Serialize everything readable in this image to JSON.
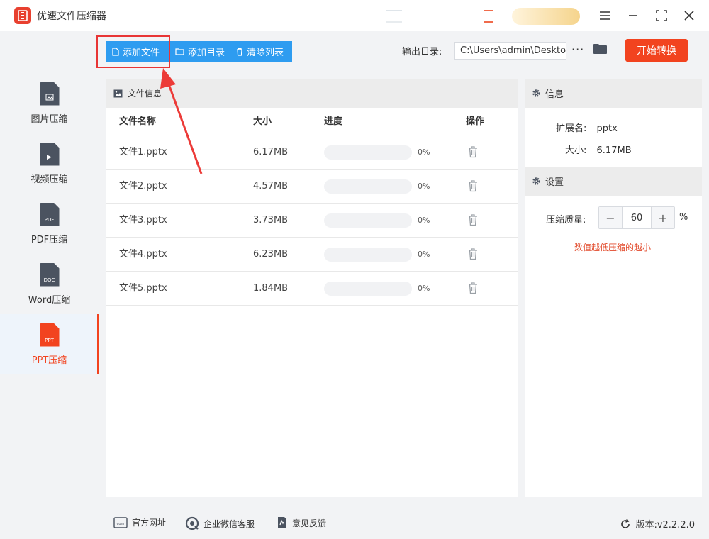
{
  "app": {
    "title": "优速文件压缩器"
  },
  "toolbar": {
    "add_file": "添加文件",
    "add_dir": "添加目录",
    "clear_list": "清除列表",
    "output_label": "输出目录:",
    "output_path": "C:\\Users\\admin\\Deskto",
    "more": "···",
    "start": "开始转换"
  },
  "sidebar": {
    "items": [
      {
        "label": "图片压缩",
        "tag": ""
      },
      {
        "label": "视频压缩",
        "tag": "▶"
      },
      {
        "label": "PDF压缩",
        "tag": "PDF"
      },
      {
        "label": "Word压缩",
        "tag": "DOC"
      },
      {
        "label": "PPT压缩",
        "tag": "PPT"
      }
    ],
    "active_index": 4
  },
  "file_panel": {
    "title": "文件信息",
    "columns": {
      "name": "文件名称",
      "size": "大小",
      "progress": "进度",
      "action": "操作"
    },
    "rows": [
      {
        "name": "文件1.pptx",
        "size": "6.17MB",
        "progress": 0,
        "progress_text": "0%"
      },
      {
        "name": "文件2.pptx",
        "size": "4.57MB",
        "progress": 0,
        "progress_text": "0%"
      },
      {
        "name": "文件3.pptx",
        "size": "3.73MB",
        "progress": 0,
        "progress_text": "0%"
      },
      {
        "name": "文件4.pptx",
        "size": "6.23MB",
        "progress": 0,
        "progress_text": "0%"
      },
      {
        "name": "文件5.pptx",
        "size": "1.84MB",
        "progress": 0,
        "progress_text": "0%"
      }
    ]
  },
  "info_panel": {
    "title": "信息",
    "ext_label": "扩展名:",
    "ext_value": "pptx",
    "size_label": "大小:",
    "size_value": "6.17MB"
  },
  "settings_panel": {
    "title": "设置",
    "quality_label": "压缩质量:",
    "quality_value": "60",
    "unit": "%",
    "minus": "−",
    "plus": "+",
    "hint": "数值越低压缩的越小"
  },
  "footer": {
    "website": "官方网址",
    "wechat": "企业微信客服",
    "feedback": "意见反馈",
    "version": "版本:v2.2.2.0"
  },
  "colors": {
    "accent": "#2e9cf0",
    "primary": "#f2431f",
    "annotation": "#e83535"
  }
}
